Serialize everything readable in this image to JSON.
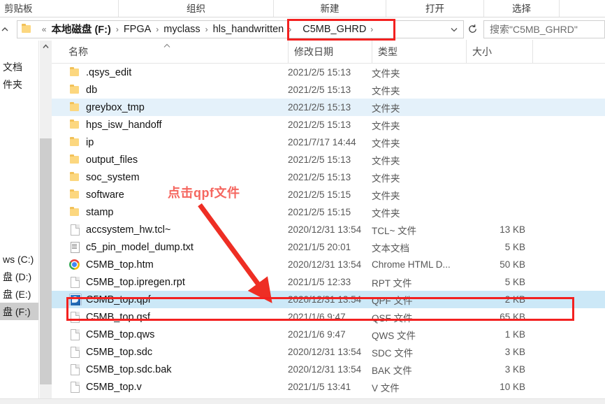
{
  "ribbon": {
    "groups": [
      {
        "label": "剪贴板"
      },
      {
        "label": "组织"
      },
      {
        "label": "新建"
      },
      {
        "label": "打开"
      },
      {
        "label": "选择"
      },
      {
        "label": ""
      }
    ]
  },
  "address_bar": {
    "up_icon": "chevron-up-icon",
    "folder_icon": "folder-icon",
    "overflow": "«",
    "crumbs": [
      {
        "label": "本地磁盘 (F:)",
        "bold": true
      },
      {
        "label": "FPGA",
        "bold": false
      },
      {
        "label": "myclass",
        "bold": false
      },
      {
        "label": "hls_handwritten",
        "bold": false
      },
      {
        "label": "C5MB_GHRD",
        "bold": false,
        "highlighted": true
      }
    ],
    "separator": "›",
    "dropdown_icon": "chevron-down-icon",
    "refresh_icon": "refresh-icon",
    "highlight_color": "#f32120"
  },
  "search": {
    "placeholder": "搜索\"C5MB_GHRD\"",
    "value": "搜索\"C5MB_GHRD\"",
    "icon": "search-icon"
  },
  "nav_pane": {
    "items": [
      {
        "label": "文档",
        "selected": false,
        "clipped": true
      },
      {
        "label": "件夹",
        "selected": false,
        "clipped": true
      },
      {
        "label": "",
        "selected": false,
        "clipped": false
      },
      {
        "label": "",
        "selected": false,
        "clipped": false
      },
      {
        "label": "",
        "selected": false,
        "clipped": false
      },
      {
        "label": "",
        "selected": false,
        "clipped": false
      },
      {
        "label": "",
        "selected": false,
        "clipped": false
      },
      {
        "label": "",
        "selected": false,
        "clipped": false
      },
      {
        "label": "",
        "selected": false,
        "clipped": false
      },
      {
        "label": "",
        "selected": false,
        "clipped": false
      },
      {
        "label": "",
        "selected": false,
        "clipped": false
      },
      {
        "label": "ws (C:)",
        "selected": false,
        "clipped": true
      },
      {
        "label": "盘 (D:)",
        "selected": false,
        "clipped": true
      },
      {
        "label": "盘 (E:)",
        "selected": false,
        "clipped": true
      },
      {
        "label": "盘 (F:)",
        "selected": true,
        "clipped": true
      }
    ],
    "scrollbar": {
      "up_arrow_icon": "chevron-up-icon"
    }
  },
  "columns": {
    "name": "名称",
    "date_modified": "修改日期",
    "type": "类型",
    "size": "大小",
    "sort_caret": "▲"
  },
  "files": [
    {
      "name": ".qsys_edit",
      "date": "2021/2/5 15:13",
      "type": "文件夹",
      "size": "",
      "icon": "folder-icon",
      "selected": false,
      "hovered": false
    },
    {
      "name": "db",
      "date": "2021/2/5 15:13",
      "type": "文件夹",
      "size": "",
      "icon": "folder-icon",
      "selected": false,
      "hovered": false
    },
    {
      "name": "greybox_tmp",
      "date": "2021/2/5 15:13",
      "type": "文件夹",
      "size": "",
      "icon": "folder-icon",
      "selected": false,
      "hovered": true
    },
    {
      "name": "hps_isw_handoff",
      "date": "2021/2/5 15:13",
      "type": "文件夹",
      "size": "",
      "icon": "folder-icon",
      "selected": false,
      "hovered": false
    },
    {
      "name": "ip",
      "date": "2021/7/17 14:44",
      "type": "文件夹",
      "size": "",
      "icon": "folder-icon",
      "selected": false,
      "hovered": false
    },
    {
      "name": "output_files",
      "date": "2021/2/5 15:13",
      "type": "文件夹",
      "size": "",
      "icon": "folder-icon",
      "selected": false,
      "hovered": false
    },
    {
      "name": "soc_system",
      "date": "2021/2/5 15:13",
      "type": "文件夹",
      "size": "",
      "icon": "folder-icon",
      "selected": false,
      "hovered": false
    },
    {
      "name": "software",
      "date": "2021/2/5 15:15",
      "type": "文件夹",
      "size": "",
      "icon": "folder-icon",
      "selected": false,
      "hovered": false
    },
    {
      "name": "stamp",
      "date": "2021/2/5 15:15",
      "type": "文件夹",
      "size": "",
      "icon": "folder-icon",
      "selected": false,
      "hovered": false
    },
    {
      "name": "accsystem_hw.tcl~",
      "date": "2020/12/31 13:54",
      "type": "TCL~ 文件",
      "size": "13 KB",
      "icon": "file-icon",
      "selected": false,
      "hovered": false
    },
    {
      "name": "c5_pin_model_dump.txt",
      "date": "2021/1/5 20:01",
      "type": "文本文档",
      "size": "5 KB",
      "icon": "text-file-icon",
      "selected": false,
      "hovered": false
    },
    {
      "name": "C5MB_top.htm",
      "date": "2020/12/31 13:54",
      "type": "Chrome HTML D...",
      "size": "50 KB",
      "icon": "chrome-icon",
      "selected": false,
      "hovered": false
    },
    {
      "name": "C5MB_top.ipregen.rpt",
      "date": "2021/1/5 12:33",
      "type": "RPT 文件",
      "size": "5 KB",
      "icon": "file-icon",
      "selected": false,
      "hovered": false
    },
    {
      "name": "C5MB_top.qpf",
      "date": "2020/12/31 13:54",
      "type": "QPF 文件",
      "size": "2 KB",
      "icon": "qpf-icon",
      "selected": true,
      "hovered": false
    },
    {
      "name": "C5MB_top.qsf",
      "date": "2021/1/6 9:47",
      "type": "QSF 文件",
      "size": "65 KB",
      "icon": "file-icon",
      "selected": false,
      "hovered": false
    },
    {
      "name": "C5MB_top.qws",
      "date": "2021/1/6 9:47",
      "type": "QWS 文件",
      "size": "1 KB",
      "icon": "file-icon",
      "selected": false,
      "hovered": false
    },
    {
      "name": "C5MB_top.sdc",
      "date": "2020/12/31 13:54",
      "type": "SDC 文件",
      "size": "3 KB",
      "icon": "file-icon",
      "selected": false,
      "hovered": false
    },
    {
      "name": "C5MB_top.sdc.bak",
      "date": "2020/12/31 13:54",
      "type": "BAK 文件",
      "size": "3 KB",
      "icon": "file-icon",
      "selected": false,
      "hovered": false
    },
    {
      "name": "C5MB_top.v",
      "date": "2021/1/5 13:41",
      "type": "V 文件",
      "size": "10 KB",
      "icon": "file-icon",
      "selected": false,
      "hovered": false
    }
  ],
  "annotation": {
    "text": "点击qpf文件",
    "text_color": "#f5665f",
    "arrow_color": "#ee2e24",
    "box_color": "#f32120"
  }
}
